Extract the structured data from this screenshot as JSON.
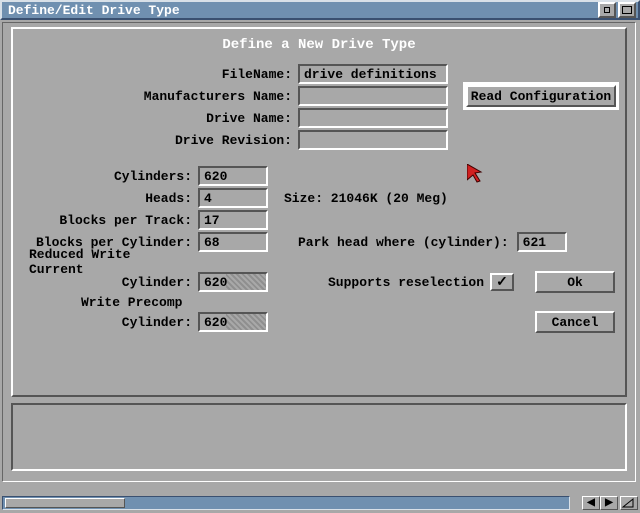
{
  "window": {
    "title": "Define/Edit Drive Type"
  },
  "panel": {
    "heading": "Define a New Drive Type"
  },
  "fields": {
    "filename_label": "FileName:",
    "filename_value": "drive definitions",
    "mfr_label": "Manufacturers Name:",
    "mfr_value": "",
    "drivename_label": "Drive Name:",
    "drivename_value": "",
    "rev_label": "Drive Revision:",
    "rev_value": ""
  },
  "geom": {
    "cyl_label": "Cylinders:",
    "cyl_value": "620",
    "heads_label": "Heads:",
    "heads_value": "4",
    "bpt_label": "Blocks per Track:",
    "bpt_value": "17",
    "bpc_label": "Blocks per Cylinder:",
    "bpc_value": "68",
    "rwc_label1": "Reduced Write Current",
    "rwc_label2": "Cylinder:",
    "rwc_value": "620",
    "wp_label1": "Write Precomp",
    "wp_label2": "Cylinder:",
    "wp_value": "620",
    "size_label": "Size: 21046K (20 Meg)",
    "park_label": "Park head where (cylinder):",
    "park_value": "621",
    "resel_label": "Supports reselection",
    "resel_checked": "✓"
  },
  "buttons": {
    "readcfg": "Read Configuration",
    "ok": "Ok",
    "cancel": "Cancel"
  },
  "colors": {
    "bg": "#a8a8a8",
    "titlebar": "#7090b0"
  }
}
